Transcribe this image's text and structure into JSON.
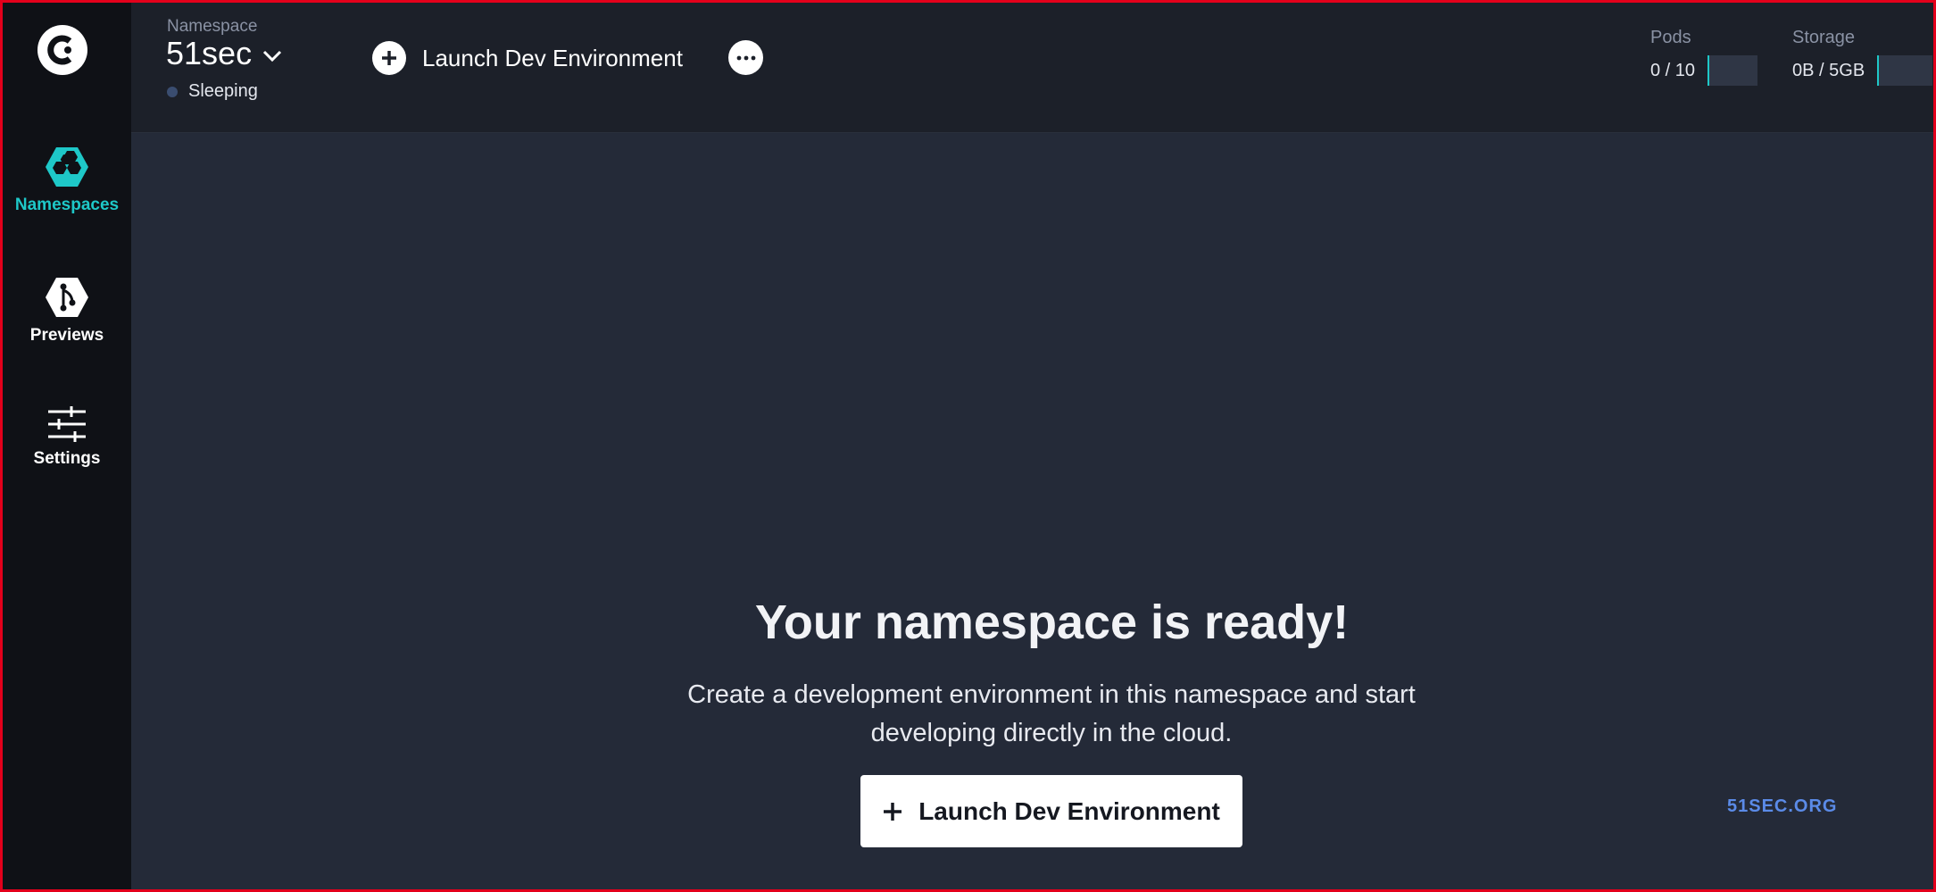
{
  "sidebar": {
    "logo_icon": "codeready-logo-icon",
    "items": [
      {
        "label": "Namespaces",
        "icon": "hexagon-cluster-icon",
        "active": true
      },
      {
        "label": "Previews",
        "icon": "git-branch-hex-icon",
        "active": false
      },
      {
        "label": "Settings",
        "icon": "sliders-icon",
        "active": false
      }
    ]
  },
  "header": {
    "namespace_caption": "Namespace",
    "namespace_name": "51sec",
    "status": "Sleeping",
    "launch_label": "Launch Dev Environment",
    "quotas": [
      {
        "label": "Pods",
        "value": "0 / 10",
        "fraction": 0
      },
      {
        "label": "Storage",
        "value": "0B / 5GB",
        "fraction": 0
      }
    ]
  },
  "main": {
    "title": "Your namespace is ready!",
    "description": "Create a development environment in this namespace and start developing directly in the cloud.",
    "launch_label": "Launch Dev Environment"
  },
  "watermark": "51SEC.ORG",
  "colors": {
    "accent": "#1ec8c8",
    "sidebar_bg": "#0f1116",
    "topbar_bg": "#1c2029",
    "main_bg": "#242a38",
    "status_dot": "#3a4d70",
    "watermark": "#5b8be8"
  }
}
